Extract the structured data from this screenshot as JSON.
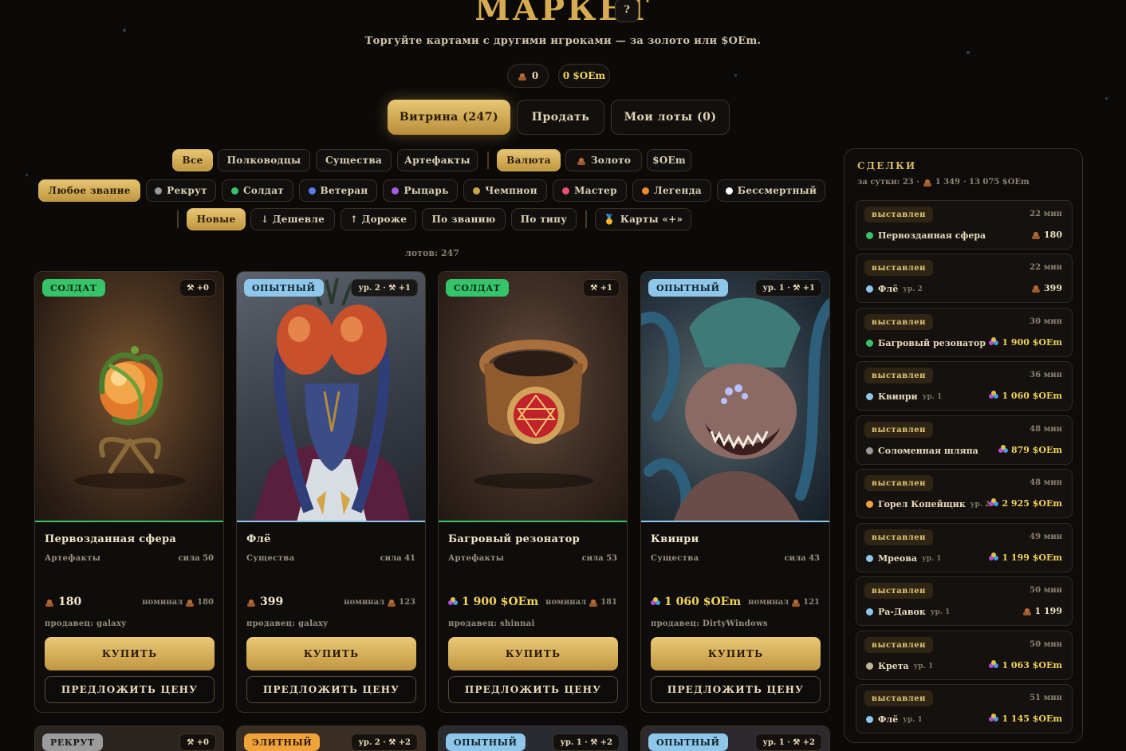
{
  "header": {
    "title": "МАРКЕТ",
    "help": "?",
    "subtitle": "Торгуйте картами с другими игроками — за золото или $OEm.",
    "balance_gold": "0",
    "balance_oem": "0 $OEm"
  },
  "tabs": [
    "Витрина (247)",
    "Продать",
    "Мои лоты (0)"
  ],
  "filters": {
    "categories": [
      "Все",
      "Полководцы",
      "Существа",
      "Артефакты"
    ],
    "currencies": [
      "Валюта",
      "Золото",
      "$OEm"
    ],
    "ranks": [
      {
        "label": "Любое звание",
        "color": ""
      },
      {
        "label": "Рекрут",
        "color": "#9a9a9a"
      },
      {
        "label": "Солдат",
        "color": "#36c26a"
      },
      {
        "label": "Ветеран",
        "color": "#5b7cf0"
      },
      {
        "label": "Рыцарь",
        "color": "#a85ae6"
      },
      {
        "label": "Чемпион",
        "color": "#c9a84a"
      },
      {
        "label": "Мастер",
        "color": "#e8506e"
      },
      {
        "label": "Легенда",
        "color": "#f08a2a"
      },
      {
        "label": "Бессмертный",
        "color": "#ffffff"
      }
    ],
    "sorts": [
      "Новые",
      "↓ Дешевле",
      "↑ Дороже",
      "По званию",
      "По типу",
      "Карты «+»"
    ]
  },
  "lots_count": "лотов: 247",
  "cards": [
    {
      "rank": "СОЛДАТ",
      "rank_color": "#35c46a",
      "level": "⚒ +0",
      "name": "Первозданная сфера",
      "type": "Артефакты",
      "power": "сила 50",
      "price": "180",
      "currency": "gold",
      "nominal": "номинал",
      "nominal_value": "180",
      "seller": "продавец: galaxy",
      "buy": "КУПИТЬ",
      "offer": "ПРЕДЛОЖИТЬ ЦЕНУ",
      "line": "#35c46a"
    },
    {
      "rank": "ОПЫТНЫЙ",
      "rank_color": "#8ec7ea",
      "level": "ур. 2 · ⚒ +1",
      "name": "Флё",
      "type": "Существа",
      "power": "сила 41",
      "price": "399",
      "currency": "gold",
      "nominal": "номинал",
      "nominal_value": "123",
      "seller": "продавец: galaxy",
      "buy": "КУПИТЬ",
      "offer": "ПРЕДЛОЖИТЬ ЦЕНУ",
      "line": "#8ec7ea"
    },
    {
      "rank": "СОЛДАТ",
      "rank_color": "#35c46a",
      "level": "⚒ +1",
      "name": "Багровый резонатор",
      "type": "Артефакты",
      "power": "сила 53",
      "price": "1 900 $OEm",
      "currency": "oem",
      "nominal": "номинал",
      "nominal_value": "181",
      "seller": "продавец: shinnai",
      "buy": "КУПИТЬ",
      "offer": "ПРЕДЛОЖИТЬ ЦЕНУ",
      "line": "#35c46a"
    },
    {
      "rank": "ОПЫТНЫЙ",
      "rank_color": "#8ec7ea",
      "level": "ур. 1 · ⚒ +1",
      "name": "Квинри",
      "type": "Существа",
      "power": "сила 43",
      "price": "1 060 $OEm",
      "currency": "oem",
      "nominal": "номинал",
      "nominal_value": "121",
      "seller": "продавец: DirtyWindows",
      "buy": "КУПИТЬ",
      "offer": "ПРЕДЛОЖИТЬ ЦЕНУ",
      "line": "#8ec7ea"
    }
  ],
  "cards_row2": [
    {
      "rank": "РЕКРУТ",
      "rank_color": "#9c9c9c",
      "level": "⚒ +0"
    },
    {
      "rank": "ЭЛИТНЫЙ",
      "rank_color": "#f0a33a",
      "level": "ур. 2 · ⚒ +2"
    },
    {
      "rank": "ОПЫТНЫЙ",
      "rank_color": "#8ec7ea",
      "level": "ур. 1 · ⚒ +2"
    },
    {
      "rank": "ОПЫТНЫЙ",
      "rank_color": "#8ec7ea",
      "level": "ур. 1 · ⚒ +2"
    }
  ],
  "deals": {
    "title": "СДЕЛКИ",
    "summary_prefix": "за сутки: 23 ·",
    "summary_gold": "1 349",
    "summary_oem": "· 13 075 $OEm",
    "items": [
      {
        "status": "выставлен",
        "time": "22 мин",
        "name": "Первозданная сфера",
        "level": "",
        "dot": "#35c46a",
        "price": "180",
        "currency": "gold"
      },
      {
        "status": "выставлен",
        "time": "22 мин",
        "name": "Флё",
        "level": "ур. 2",
        "dot": "#8ec7ea",
        "price": "399",
        "currency": "gold"
      },
      {
        "status": "выставлен",
        "time": "30 мин",
        "name": "Багровый резонатор",
        "level": "",
        "dot": "#35c46a",
        "price": "1 900 $OEm",
        "currency": "oem"
      },
      {
        "status": "выставлен",
        "time": "36 мин",
        "name": "Квинри",
        "level": "ур. 1",
        "dot": "#8ec7ea",
        "price": "1 060 $OEm",
        "currency": "oem"
      },
      {
        "status": "выставлен",
        "time": "48 мин",
        "name": "Соломенная шляпа",
        "level": "",
        "dot": "#9a9a9a",
        "price": "879 $OEm",
        "currency": "oem"
      },
      {
        "status": "выставлен",
        "time": "48 мин",
        "name": "Горел Копейщик",
        "level": "ур. 2",
        "dot": "#f0a33a",
        "price": "2 925 $OEm",
        "currency": "oem"
      },
      {
        "status": "выставлен",
        "time": "49 мин",
        "name": "Мреова",
        "level": "ур. 1",
        "dot": "#8ec7ea",
        "price": "1 199 $OEm",
        "currency": "oem"
      },
      {
        "status": "выставлен",
        "time": "50 мин",
        "name": "Ра-Давок",
        "level": "ур. 1",
        "dot": "#8ec7ea",
        "price": "1 199",
        "currency": "gold"
      },
      {
        "status": "выставлен",
        "time": "50 мин",
        "name": "Крета",
        "level": "ур. 1",
        "dot": "#c2b59a",
        "price": "1 063 $OEm",
        "currency": "oem"
      },
      {
        "status": "выставлен",
        "time": "51 мин",
        "name": "Флё",
        "level": "ур. 1",
        "dot": "#8ec7ea",
        "price": "1 145 $OEm",
        "currency": "oem"
      }
    ]
  }
}
